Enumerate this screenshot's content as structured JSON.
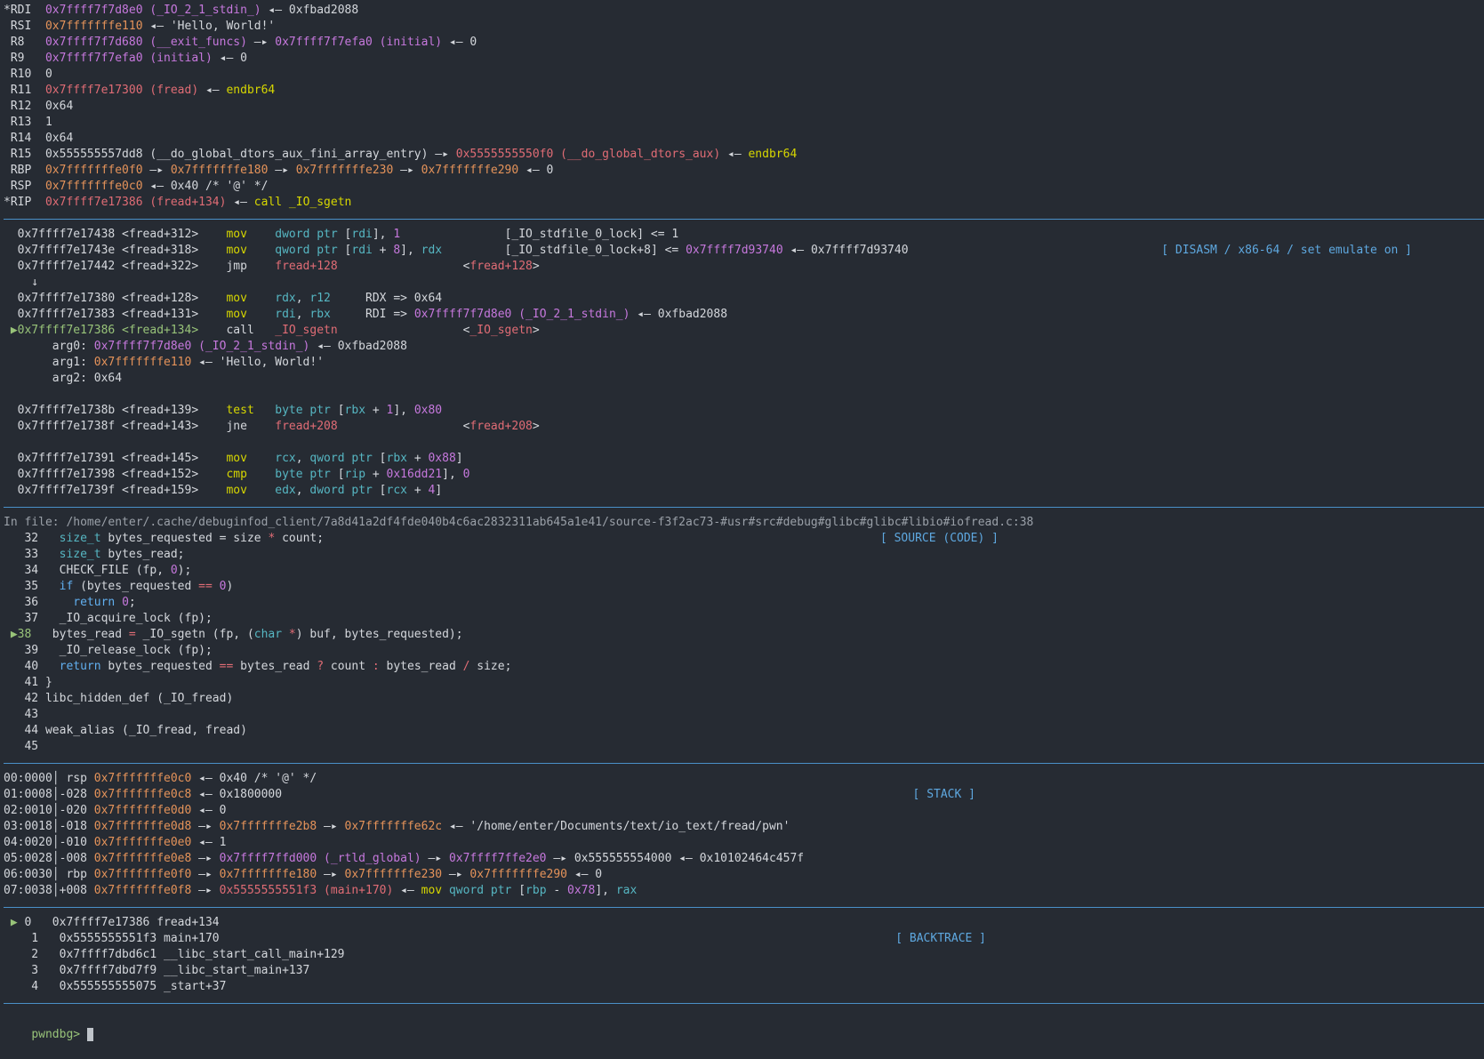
{
  "registers": [
    {
      "mark": "*",
      "name": "RDI",
      "parts": [
        [
          "pur",
          "0x7ffff7f7d8e0 (_IO_2_1_stdin_)"
        ],
        [
          "wht",
          " ◂— 0xfbad2088"
        ]
      ]
    },
    {
      "mark": " ",
      "name": "RSI",
      "parts": [
        [
          "ora",
          "0x7fffffffe110"
        ],
        [
          "wht",
          " ◂— 'Hello, World!'"
        ]
      ]
    },
    {
      "mark": " ",
      "name": "R8 ",
      "parts": [
        [
          "pur",
          "0x7ffff7f7d680 (__exit_funcs)"
        ],
        [
          "wht",
          " —▸ "
        ],
        [
          "pur",
          "0x7ffff7f7efa0 (initial)"
        ],
        [
          "wht",
          " ◂— 0"
        ]
      ]
    },
    {
      "mark": " ",
      "name": "R9 ",
      "parts": [
        [
          "pur",
          "0x7ffff7f7efa0 (initial)"
        ],
        [
          "wht",
          " ◂— 0"
        ]
      ]
    },
    {
      "mark": " ",
      "name": "R10",
      "parts": [
        [
          "wht",
          "0"
        ]
      ]
    },
    {
      "mark": " ",
      "name": "R11",
      "parts": [
        [
          "red",
          "0x7ffff7e17300 (fread)"
        ],
        [
          "wht",
          " ◂— "
        ],
        [
          "yel",
          "endbr64"
        ]
      ]
    },
    {
      "mark": " ",
      "name": "R12",
      "parts": [
        [
          "wht",
          "0x64"
        ]
      ]
    },
    {
      "mark": " ",
      "name": "R13",
      "parts": [
        [
          "wht",
          "1"
        ]
      ]
    },
    {
      "mark": " ",
      "name": "R14",
      "parts": [
        [
          "wht",
          "0x64"
        ]
      ]
    },
    {
      "mark": " ",
      "name": "R15",
      "parts": [
        [
          "wht",
          "0x555555557dd8 (__do_global_dtors_aux_fini_array_entry) —▸ "
        ],
        [
          "red",
          "0x5555555550f0 (__do_global_dtors_aux)"
        ],
        [
          "wht",
          " ◂— "
        ],
        [
          "yel",
          "endbr64"
        ]
      ]
    },
    {
      "mark": " ",
      "name": "RBP",
      "parts": [
        [
          "ora",
          "0x7fffffffe0f0"
        ],
        [
          "wht",
          " —▸ "
        ],
        [
          "ora",
          "0x7fffffffe180"
        ],
        [
          "wht",
          " —▸ "
        ],
        [
          "ora",
          "0x7fffffffe230"
        ],
        [
          "wht",
          " —▸ "
        ],
        [
          "ora",
          "0x7fffffffe290"
        ],
        [
          "wht",
          " ◂— 0"
        ]
      ]
    },
    {
      "mark": " ",
      "name": "RSP",
      "parts": [
        [
          "ora",
          "0x7fffffffe0c0"
        ],
        [
          "wht",
          " ◂— 0x40 /* '@' */"
        ]
      ]
    },
    {
      "mark": "*",
      "name": "RIP",
      "parts": [
        [
          "red",
          "0x7ffff7e17386 (fread+134)"
        ],
        [
          "wht",
          " ◂— "
        ],
        [
          "yel",
          "call _IO_sgetn"
        ]
      ]
    }
  ],
  "disasm_title": "[ DISASM / x86-64 / set emulate on ]",
  "disasm": [
    {
      "mark": "  ",
      "parts": [
        [
          "wht",
          "0x7ffff7e17438 <fread+312>    "
        ],
        [
          "yel",
          "mov"
        ],
        [
          "wht",
          "    "
        ],
        [
          "cyn",
          "dword ptr"
        ],
        [
          "wht",
          " ["
        ],
        [
          "cyn",
          "rdi"
        ],
        [
          "wht",
          "], "
        ],
        [
          "num",
          "1"
        ],
        [
          "wht",
          "               [_IO_stdfile_0_lock] <= 1"
        ]
      ]
    },
    {
      "mark": "  ",
      "parts": [
        [
          "wht",
          "0x7ffff7e1743e <fread+318>    "
        ],
        [
          "yel",
          "mov"
        ],
        [
          "wht",
          "    "
        ],
        [
          "cyn",
          "qword ptr"
        ],
        [
          "wht",
          " ["
        ],
        [
          "cyn",
          "rdi"
        ],
        [
          "wht",
          " + "
        ],
        [
          "num",
          "8"
        ],
        [
          "wht",
          "], "
        ],
        [
          "cyn",
          "rdx"
        ],
        [
          "wht",
          "         [_IO_stdfile_0_lock+8] <= "
        ],
        [
          "pur",
          "0x7ffff7d93740"
        ],
        [
          "wht",
          " ◂— 0x7ffff7d93740"
        ]
      ]
    },
    {
      "mark": "  ",
      "parts": [
        [
          "wht",
          "0x7ffff7e17442 <fread+322>    jmp    "
        ],
        [
          "red",
          "fread+128"
        ],
        [
          "wht",
          "                  <"
        ],
        [
          "red",
          "fread+128"
        ],
        [
          "wht",
          ">"
        ]
      ]
    },
    {
      "mark": "  ",
      "parts": [
        [
          "wht",
          "  ↓"
        ]
      ]
    },
    {
      "mark": "  ",
      "parts": [
        [
          "wht",
          "0x7ffff7e17380 <fread+128>    "
        ],
        [
          "yel",
          "mov"
        ],
        [
          "wht",
          "    "
        ],
        [
          "cyn",
          "rdx"
        ],
        [
          "wht",
          ", "
        ],
        [
          "cyn",
          "r12"
        ],
        [
          "wht",
          "     RDX => 0x64"
        ]
      ]
    },
    {
      "mark": "  ",
      "parts": [
        [
          "wht",
          "0x7ffff7e17383 <fread+131>    "
        ],
        [
          "yel",
          "mov"
        ],
        [
          "wht",
          "    "
        ],
        [
          "cyn",
          "rdi"
        ],
        [
          "wht",
          ", "
        ],
        [
          "cyn",
          "rbx"
        ],
        [
          "wht",
          "     RDI => "
        ],
        [
          "pur",
          "0x7ffff7f7d8e0 (_IO_2_1_stdin_)"
        ],
        [
          "wht",
          " ◂— 0xfbad2088"
        ]
      ]
    },
    {
      "mark": " ▶",
      "parts": [
        [
          "grn",
          "0x7ffff7e17386 <fread+134>"
        ],
        [
          "wht",
          "    call   "
        ],
        [
          "red",
          "_IO_sgetn"
        ],
        [
          "wht",
          "                  <"
        ],
        [
          "red",
          "_IO_sgetn"
        ],
        [
          "wht",
          ">"
        ]
      ]
    },
    {
      "mark": "  ",
      "parts": [
        [
          "wht",
          "     arg0: "
        ],
        [
          "pur",
          "0x7ffff7f7d8e0 (_IO_2_1_stdin_)"
        ],
        [
          "wht",
          " ◂— 0xfbad2088"
        ]
      ]
    },
    {
      "mark": "  ",
      "parts": [
        [
          "wht",
          "     arg1: "
        ],
        [
          "ora",
          "0x7fffffffe110"
        ],
        [
          "wht",
          " ◂— 'Hello, World!'"
        ]
      ]
    },
    {
      "mark": "  ",
      "parts": [
        [
          "wht",
          "     arg2: 0x64"
        ]
      ]
    },
    {
      "mark": "  ",
      "parts": [
        [
          "wht",
          ""
        ]
      ]
    },
    {
      "mark": "  ",
      "parts": [
        [
          "wht",
          "0x7ffff7e1738b <fread+139>    "
        ],
        [
          "yel",
          "test"
        ],
        [
          "wht",
          "   "
        ],
        [
          "cyn",
          "byte ptr"
        ],
        [
          "wht",
          " ["
        ],
        [
          "cyn",
          "rbx"
        ],
        [
          "wht",
          " + "
        ],
        [
          "num",
          "1"
        ],
        [
          "wht",
          "], "
        ],
        [
          "num",
          "0x80"
        ]
      ]
    },
    {
      "mark": "  ",
      "parts": [
        [
          "wht",
          "0x7ffff7e1738f <fread+143>    jne    "
        ],
        [
          "red",
          "fread+208"
        ],
        [
          "wht",
          "                  <"
        ],
        [
          "red",
          "fread+208"
        ],
        [
          "wht",
          ">"
        ]
      ]
    },
    {
      "mark": "  ",
      "parts": [
        [
          "wht",
          ""
        ]
      ]
    },
    {
      "mark": "  ",
      "parts": [
        [
          "wht",
          "0x7ffff7e17391 <fread+145>    "
        ],
        [
          "yel",
          "mov"
        ],
        [
          "wht",
          "    "
        ],
        [
          "cyn",
          "rcx"
        ],
        [
          "wht",
          ", "
        ],
        [
          "cyn",
          "qword ptr"
        ],
        [
          "wht",
          " ["
        ],
        [
          "cyn",
          "rbx"
        ],
        [
          "wht",
          " + "
        ],
        [
          "num",
          "0x88"
        ],
        [
          "wht",
          "]"
        ]
      ]
    },
    {
      "mark": "  ",
      "parts": [
        [
          "wht",
          "0x7ffff7e17398 <fread+152>    "
        ],
        [
          "yel",
          "cmp"
        ],
        [
          "wht",
          "    "
        ],
        [
          "cyn",
          "byte ptr"
        ],
        [
          "wht",
          " ["
        ],
        [
          "cyn",
          "rip"
        ],
        [
          "wht",
          " + "
        ],
        [
          "num",
          "0x16dd21"
        ],
        [
          "wht",
          "], "
        ],
        [
          "num",
          "0"
        ]
      ]
    },
    {
      "mark": "  ",
      "parts": [
        [
          "wht",
          "0x7ffff7e1739f <fread+159>    "
        ],
        [
          "yel",
          "mov"
        ],
        [
          "wht",
          "    "
        ],
        [
          "cyn",
          "edx"
        ],
        [
          "wht",
          ", "
        ],
        [
          "cyn",
          "dword ptr"
        ],
        [
          "wht",
          " ["
        ],
        [
          "cyn",
          "rcx"
        ],
        [
          "wht",
          " + "
        ],
        [
          "num",
          "4"
        ],
        [
          "wht",
          "]"
        ]
      ]
    }
  ],
  "source_title": "[ SOURCE (CODE) ]",
  "source_file": "In file: /home/enter/.cache/debuginfod_client/7a8d41a2df4fde040b4c6ac2832311ab645a1e41/source-f3f2ac73-#usr#src#debug#glibc#glibc#libio#iofread.c:38",
  "source": [
    {
      "mark": "  ",
      "parts": [
        [
          "wht",
          " 32   "
        ],
        [
          "cyn",
          "size_t"
        ],
        [
          "wht",
          " bytes_requested = size "
        ],
        [
          "red",
          "*"
        ],
        [
          "wht",
          " count;"
        ]
      ]
    },
    {
      "mark": "  ",
      "parts": [
        [
          "wht",
          " 33   "
        ],
        [
          "cyn",
          "size_t"
        ],
        [
          "wht",
          " bytes_read;"
        ]
      ]
    },
    {
      "mark": "  ",
      "parts": [
        [
          "wht",
          " 34   CHECK_FILE (fp, "
        ],
        [
          "num",
          "0"
        ],
        [
          "wht",
          ");"
        ]
      ]
    },
    {
      "mark": "  ",
      "parts": [
        [
          "wht",
          " 35   "
        ],
        [
          "blu",
          "if"
        ],
        [
          "wht",
          " (bytes_requested "
        ],
        [
          "red",
          "=="
        ],
        [
          "wht",
          " "
        ],
        [
          "num",
          "0"
        ],
        [
          "wht",
          ")"
        ]
      ]
    },
    {
      "mark": "  ",
      "parts": [
        [
          "wht",
          " 36     "
        ],
        [
          "blu",
          "return"
        ],
        [
          "wht",
          " "
        ],
        [
          "num",
          "0"
        ],
        [
          "wht",
          ";"
        ]
      ]
    },
    {
      "mark": "  ",
      "parts": [
        [
          "wht",
          " 37   _IO_acquire_lock (fp);"
        ]
      ]
    },
    {
      "mark": " ▶",
      "parts": [
        [
          "grn",
          "38"
        ],
        [
          "wht",
          "   bytes_read "
        ],
        [
          "red",
          "="
        ],
        [
          "wht",
          " _IO_sgetn (fp, ("
        ],
        [
          "cyn",
          "char"
        ],
        [
          "wht",
          " "
        ],
        [
          "red",
          "*"
        ],
        [
          "wht",
          ") buf, bytes_requested);"
        ]
      ]
    },
    {
      "mark": "  ",
      "parts": [
        [
          "wht",
          " 39   _IO_release_lock (fp);"
        ]
      ]
    },
    {
      "mark": "  ",
      "parts": [
        [
          "wht",
          " 40   "
        ],
        [
          "blu",
          "return"
        ],
        [
          "wht",
          " bytes_requested "
        ],
        [
          "red",
          "=="
        ],
        [
          "wht",
          " bytes_read "
        ],
        [
          "red",
          "?"
        ],
        [
          "wht",
          " count "
        ],
        [
          "red",
          ":"
        ],
        [
          "wht",
          " bytes_read "
        ],
        [
          "red",
          "/"
        ],
        [
          "wht",
          " size;"
        ]
      ]
    },
    {
      "mark": "  ",
      "parts": [
        [
          "wht",
          " 41 }"
        ]
      ]
    },
    {
      "mark": "  ",
      "parts": [
        [
          "wht",
          " 42 libc_hidden_def (_IO_fread)"
        ]
      ]
    },
    {
      "mark": "  ",
      "parts": [
        [
          "wht",
          " 43"
        ]
      ]
    },
    {
      "mark": "  ",
      "parts": [
        [
          "wht",
          " 44 weak_alias (_IO_fread, fread)"
        ]
      ]
    },
    {
      "mark": "  ",
      "parts": [
        [
          "wht",
          " 45"
        ]
      ]
    }
  ],
  "stack_title": "[ STACK ]",
  "stack": [
    {
      "parts": [
        [
          "wht",
          "00:0000│ rsp "
        ],
        [
          "ora",
          "0x7fffffffe0c0"
        ],
        [
          "wht",
          " ◂— 0x40 /* '@' */"
        ]
      ]
    },
    {
      "parts": [
        [
          "wht",
          "01:0008│-028 "
        ],
        [
          "ora",
          "0x7fffffffe0c8"
        ],
        [
          "wht",
          " ◂— 0x1800000"
        ]
      ]
    },
    {
      "parts": [
        [
          "wht",
          "02:0010│-020 "
        ],
        [
          "ora",
          "0x7fffffffe0d0"
        ],
        [
          "wht",
          " ◂— 0"
        ]
      ]
    },
    {
      "parts": [
        [
          "wht",
          "03:0018│-018 "
        ],
        [
          "ora",
          "0x7fffffffe0d8"
        ],
        [
          "wht",
          " —▸ "
        ],
        [
          "ora",
          "0x7fffffffe2b8"
        ],
        [
          "wht",
          " —▸ "
        ],
        [
          "ora",
          "0x7fffffffe62c"
        ],
        [
          "wht",
          " ◂— '/home/enter/Documents/text/io_text/fread/pwn'"
        ]
      ]
    },
    {
      "parts": [
        [
          "wht",
          "04:0020│-010 "
        ],
        [
          "ora",
          "0x7fffffffe0e0"
        ],
        [
          "wht",
          " ◂— 1"
        ]
      ]
    },
    {
      "parts": [
        [
          "wht",
          "05:0028│-008 "
        ],
        [
          "ora",
          "0x7fffffffe0e8"
        ],
        [
          "wht",
          " —▸ "
        ],
        [
          "pur",
          "0x7ffff7ffd000 (_rtld_global)"
        ],
        [
          "wht",
          " —▸ "
        ],
        [
          "pur",
          "0x7ffff7ffe2e0"
        ],
        [
          "wht",
          " —▸ 0x555555554000 ◂— 0x10102464c457f"
        ]
      ]
    },
    {
      "parts": [
        [
          "wht",
          "06:0030│ rbp "
        ],
        [
          "ora",
          "0x7fffffffe0f0"
        ],
        [
          "wht",
          " —▸ "
        ],
        [
          "ora",
          "0x7fffffffe180"
        ],
        [
          "wht",
          " —▸ "
        ],
        [
          "ora",
          "0x7fffffffe230"
        ],
        [
          "wht",
          " —▸ "
        ],
        [
          "ora",
          "0x7fffffffe290"
        ],
        [
          "wht",
          " ◂— 0"
        ]
      ]
    },
    {
      "parts": [
        [
          "wht",
          "07:0038│+008 "
        ],
        [
          "ora",
          "0x7fffffffe0f8"
        ],
        [
          "wht",
          " —▸ "
        ],
        [
          "red",
          "0x5555555551f3 (main+170)"
        ],
        [
          "wht",
          " ◂— "
        ],
        [
          "yel",
          "mov"
        ],
        [
          "wht",
          " "
        ],
        [
          "cyn",
          "qword ptr"
        ],
        [
          "wht",
          " ["
        ],
        [
          "cyn",
          "rbp"
        ],
        [
          "wht",
          " - "
        ],
        [
          "num",
          "0x78"
        ],
        [
          "wht",
          "], "
        ],
        [
          "cyn",
          "rax"
        ]
      ]
    }
  ],
  "backtrace_title": "[ BACKTRACE ]",
  "backtrace": [
    {
      "mark": " ▶",
      "parts": [
        [
          "wht",
          " 0   0x7ffff7e17386 fread+134"
        ]
      ]
    },
    {
      "mark": "  ",
      "parts": [
        [
          "wht",
          "  1   0x5555555551f3 main+170"
        ]
      ]
    },
    {
      "mark": "  ",
      "parts": [
        [
          "wht",
          "  2   0x7ffff7dbd6c1 __libc_start_call_main+129"
        ]
      ]
    },
    {
      "mark": "  ",
      "parts": [
        [
          "wht",
          "  3   0x7ffff7dbd7f9 __libc_start_main+137"
        ]
      ]
    },
    {
      "mark": "  ",
      "parts": [
        [
          "wht",
          "  4   0x555555555075 _start+37"
        ]
      ]
    }
  ],
  "prompt": "pwndbg> ",
  "colors": {
    "background": "#262b33",
    "rule": "#4a90c8",
    "title": "#5ea8e0"
  }
}
